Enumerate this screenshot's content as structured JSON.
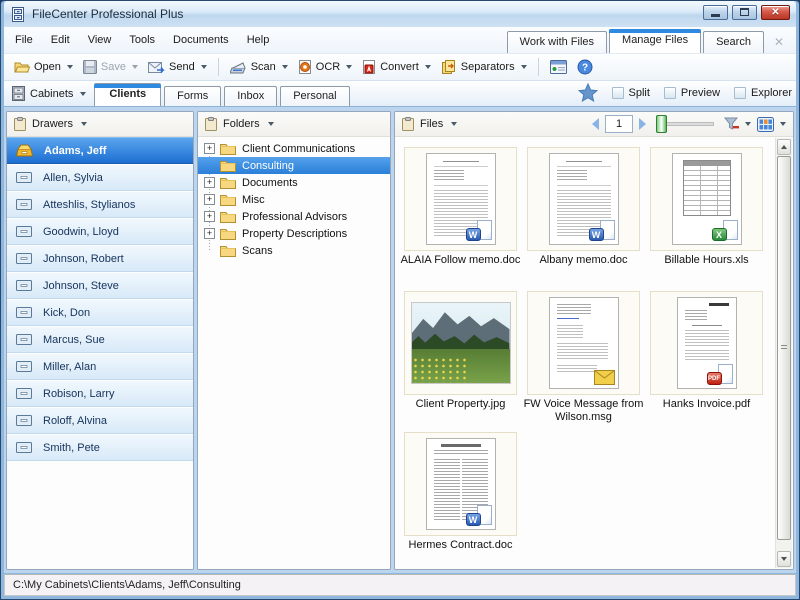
{
  "window": {
    "title": "FileCenter Professional Plus"
  },
  "menu": {
    "items": [
      "File",
      "Edit",
      "View",
      "Tools",
      "Documents",
      "Help"
    ]
  },
  "mode_tabs": {
    "tabs": [
      {
        "label": "Work with Files"
      },
      {
        "label": "Manage Files"
      },
      {
        "label": "Search"
      }
    ],
    "active": "Manage Files"
  },
  "toolbar": {
    "open": "Open",
    "save": "Save",
    "send": "Send",
    "scan": "Scan",
    "ocr": "OCR",
    "convert": "Convert",
    "separators": "Separators"
  },
  "cabinet_bar": {
    "cabinets": "Cabinets",
    "tabs": [
      "Clients",
      "Forms",
      "Inbox",
      "Personal"
    ],
    "active_tab": "Clients",
    "split": "Split",
    "preview": "Preview",
    "explorer": "Explorer"
  },
  "drawers": {
    "title": "Drawers",
    "selected": "Adams, Jeff",
    "items": [
      "Adams, Jeff",
      "Allen, Sylvia",
      "Atteshlis, Stylianos",
      "Goodwin, Lloyd",
      "Johnson, Robert",
      "Johnson, Steve",
      "Kick, Don",
      "Marcus, Sue",
      "Miller, Alan",
      "Robison, Larry",
      "Roloff, Alvina",
      "Smith, Pete"
    ]
  },
  "folders": {
    "title": "Folders",
    "selected": "Consulting",
    "items": [
      {
        "label": "Client Communications",
        "expandable": true
      },
      {
        "label": "Consulting",
        "expandable": false
      },
      {
        "label": "Documents",
        "expandable": true
      },
      {
        "label": "Misc",
        "expandable": true
      },
      {
        "label": "Professional Advisors",
        "expandable": true
      },
      {
        "label": "Property Descriptions",
        "expandable": true
      },
      {
        "label": "Scans",
        "expandable": false
      }
    ]
  },
  "files": {
    "title": "Files",
    "page_number": "1",
    "items": [
      {
        "name": "ALAIA Follow memo.doc",
        "type": "word"
      },
      {
        "name": "Albany memo.doc",
        "type": "word"
      },
      {
        "name": "Billable Hours.xls",
        "type": "excel"
      },
      {
        "name": "Client Property.jpg",
        "type": "image"
      },
      {
        "name": "FW Voice Message from Wilson.msg",
        "type": "email"
      },
      {
        "name": "Hanks Invoice.pdf",
        "type": "pdf"
      },
      {
        "name": "Hermes Contract.doc",
        "type": "word"
      }
    ]
  },
  "icons": {
    "word_letter": "W",
    "excel_letter": "X",
    "pdf_label": "PDF",
    "help": "?",
    "expand_plus": "+",
    "close_x": "✕"
  },
  "status_bar": {
    "path": "C:\\My Cabinets\\Clients\\Adams, Jeff\\Consulting"
  },
  "colors": {
    "accent": "#2E8AE0",
    "selection_start": "#55A1EC",
    "selection_end": "#1D6ED2",
    "content_bg": "#BCD5EE"
  }
}
